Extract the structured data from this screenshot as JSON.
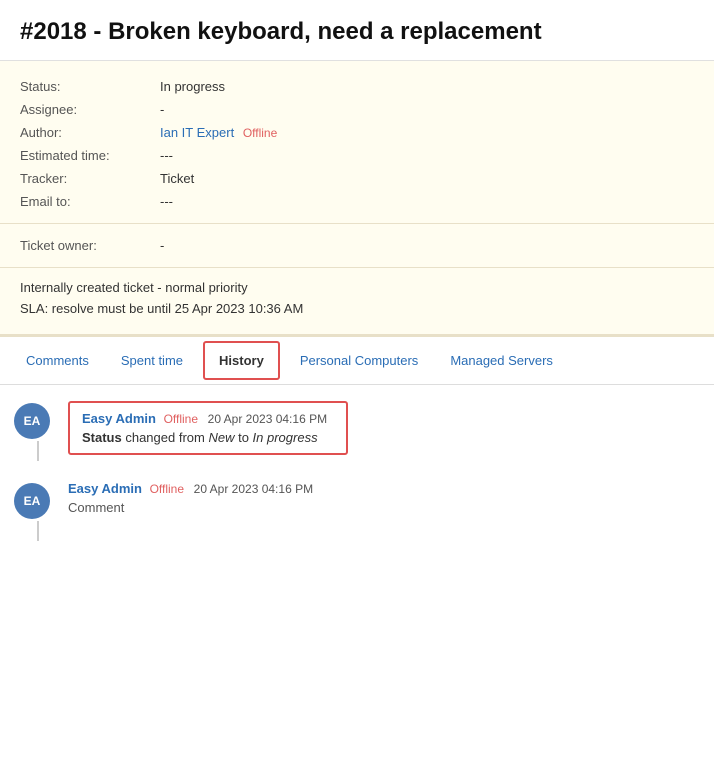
{
  "page": {
    "title": "#2018 - Broken keyboard, need a replacement"
  },
  "info": {
    "status_label": "Status:",
    "status_value": "In progress",
    "assignee_label": "Assignee:",
    "assignee_value": "-",
    "author_label": "Author:",
    "author_name": "Ian IT Expert",
    "author_status": "Offline",
    "estimated_label": "Estimated time:",
    "estimated_value": "---",
    "tracker_label": "Tracker:",
    "tracker_value": "Ticket",
    "email_label": "Email to:",
    "email_value": "---",
    "ticket_owner_label": "Ticket owner:",
    "ticket_owner_value": "-"
  },
  "notes": {
    "line1": "Internally created ticket - normal priority",
    "line2": "SLA: resolve must be until 25 Apr 2023 10:36 AM"
  },
  "tabs": {
    "comments": "Comments",
    "spent_time": "Spent time",
    "history": "History",
    "personal_computers": "Personal Computers",
    "managed_servers": "Managed Servers"
  },
  "history": {
    "entries": [
      {
        "avatar": "EA",
        "author": "Easy Admin",
        "status": "Offline",
        "date": "20 Apr 2023 04:16 PM",
        "action_prefix": "Status",
        "action_text": " changed from ",
        "from_value": "New",
        "to_text": " to ",
        "to_value": "In progress",
        "highlighted": true
      },
      {
        "avatar": "EA",
        "author": "Easy Admin",
        "status": "Offline",
        "date": "20 Apr 2023 04:16 PM",
        "comment": "Comment",
        "highlighted": false
      }
    ]
  }
}
